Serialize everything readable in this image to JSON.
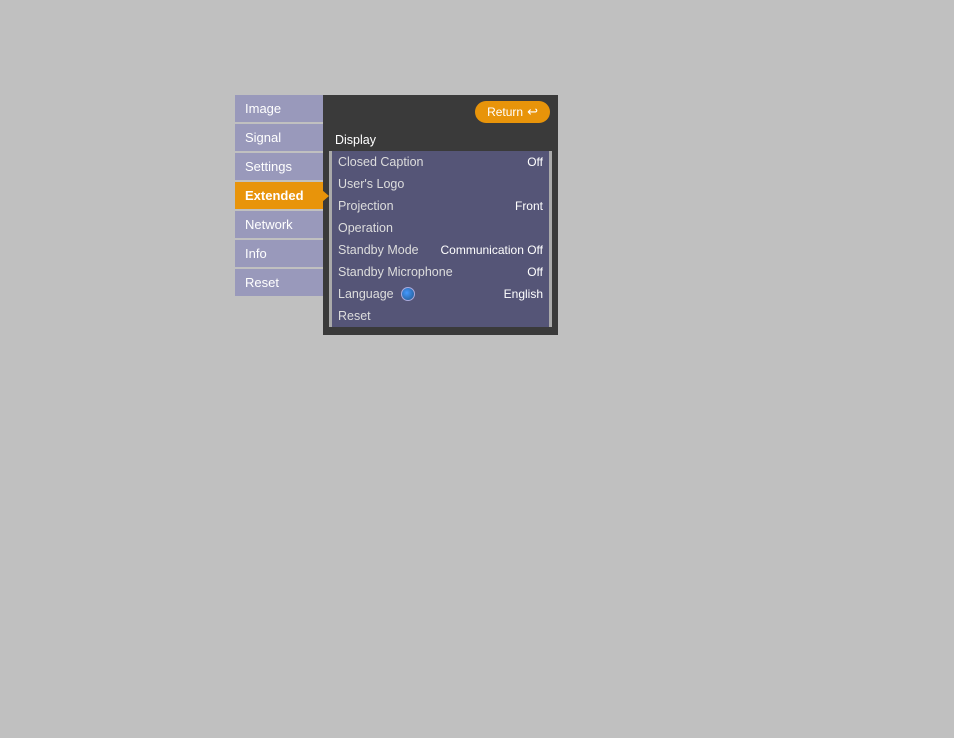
{
  "sidebar": {
    "items": [
      {
        "id": "image",
        "label": "Image",
        "active": false
      },
      {
        "id": "signal",
        "label": "Signal",
        "active": false
      },
      {
        "id": "settings",
        "label": "Settings",
        "active": false
      },
      {
        "id": "extended",
        "label": "Extended",
        "active": true
      },
      {
        "id": "network",
        "label": "Network",
        "active": false
      },
      {
        "id": "info",
        "label": "Info",
        "active": false
      },
      {
        "id": "reset",
        "label": "Reset",
        "active": false
      }
    ]
  },
  "panel": {
    "return_label": "Return",
    "rows": [
      {
        "id": "display",
        "label": "Display",
        "value": "",
        "highlighted": false
      },
      {
        "id": "closed-caption",
        "label": "Closed Caption",
        "value": "Off",
        "highlighted": false
      },
      {
        "id": "users-logo",
        "label": "User's Logo",
        "value": "",
        "highlighted": false
      },
      {
        "id": "projection",
        "label": "Projection",
        "value": "Front",
        "highlighted": false
      },
      {
        "id": "operation",
        "label": "Operation",
        "value": "",
        "highlighted": false
      },
      {
        "id": "standby-mode",
        "label": "Standby Mode",
        "value": "Communication Off",
        "highlighted": false
      },
      {
        "id": "standby-microphone",
        "label": "Standby Microphone",
        "value": "Off",
        "highlighted": false
      },
      {
        "id": "language",
        "label": "Language",
        "value": "English",
        "has_globe": true,
        "highlighted": false
      },
      {
        "id": "reset",
        "label": "Reset",
        "value": "",
        "highlighted": false
      }
    ]
  }
}
